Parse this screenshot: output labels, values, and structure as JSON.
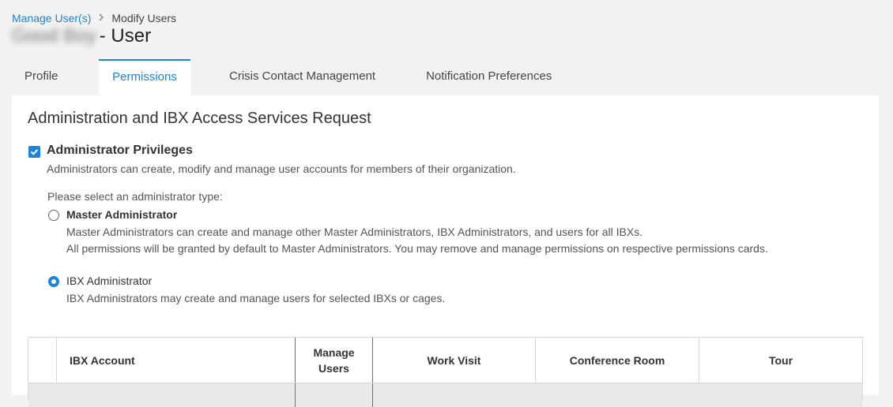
{
  "breadcrumb": {
    "parent": "Manage User(s)",
    "current": "Modify Users"
  },
  "header": {
    "user_name": "Good Boy",
    "title_suffix": "- User"
  },
  "tabs": [
    {
      "label": "Profile",
      "active": false
    },
    {
      "label": "Permissions",
      "active": true
    },
    {
      "label": "Crisis Contact Management",
      "active": false
    },
    {
      "label": "Notification Preferences",
      "active": false
    }
  ],
  "section": {
    "title": "Administration and IBX Access Services Request",
    "admin_privileges": {
      "label": "Administrator Privileges",
      "checked": true,
      "description": "Administrators can create, modify and manage user accounts for members of their organization."
    },
    "select_prompt": "Please select an administrator type:",
    "options": [
      {
        "label": "Master Administrator",
        "selected": false,
        "description_lines": [
          "Master Administrators can create and manage other Master Administrators, IBX Administrators, and users for all IBXs.",
          "All permissions will be granted by default to Master Administrators. You may remove and manage permissions on respective permissions cards."
        ]
      },
      {
        "label": "IBX Administrator",
        "selected": true,
        "description_lines": [
          "IBX Administrators may create and manage users for selected IBXs or cages."
        ]
      }
    ]
  },
  "table": {
    "columns": [
      "IBX Account",
      "Manage Users",
      "Work Visit",
      "Conference Room",
      "Tour"
    ]
  },
  "colors": {
    "accent": "#1a84d6",
    "background": "#f2f2f2",
    "panel": "#ffffff"
  }
}
